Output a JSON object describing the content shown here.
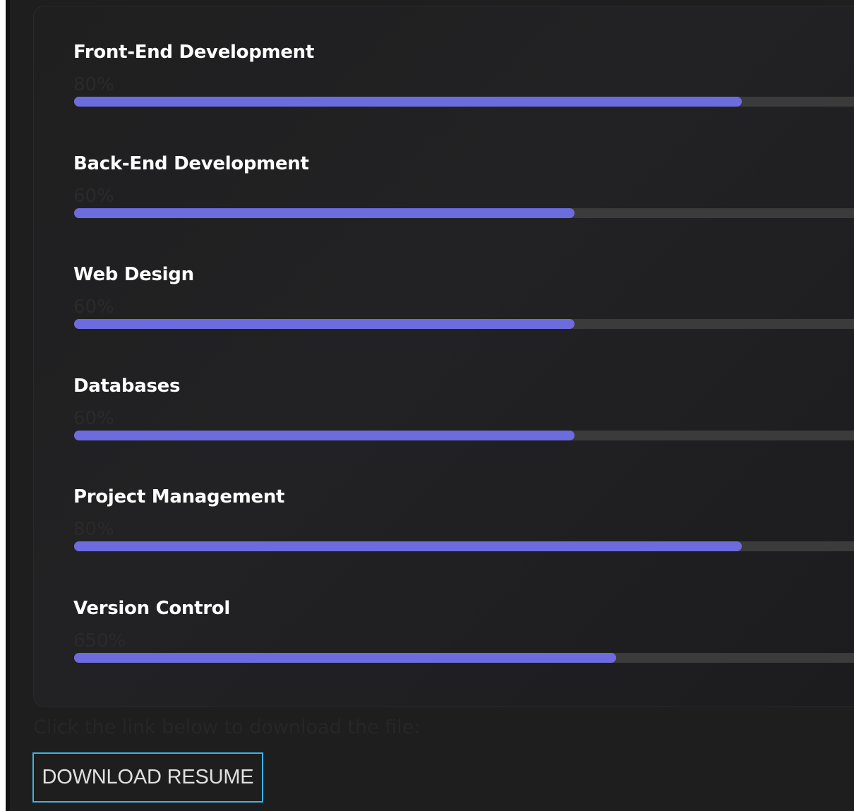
{
  "skills": [
    {
      "name": "Front-End Development",
      "percent_label": "80%",
      "level": 0.8
    },
    {
      "name": "Back-End Development",
      "percent_label": "60%",
      "level": 0.6
    },
    {
      "name": "Web Design",
      "percent_label": "60%",
      "level": 0.6
    },
    {
      "name": "Databases",
      "percent_label": "60%",
      "level": 0.6
    },
    {
      "name": "Project Management",
      "percent_label": "80%",
      "level": 0.8
    },
    {
      "name": "Version Control",
      "percent_label": "650%",
      "level": 0.65
    }
  ],
  "download": {
    "note": "Click the link below to download the file:",
    "button_label": "DOWNLOAD RESUME"
  },
  "colors": {
    "bar_fill": "#6c6cdf",
    "bar_track": "#3b3b3b",
    "button_border": "#3ab4e8"
  }
}
